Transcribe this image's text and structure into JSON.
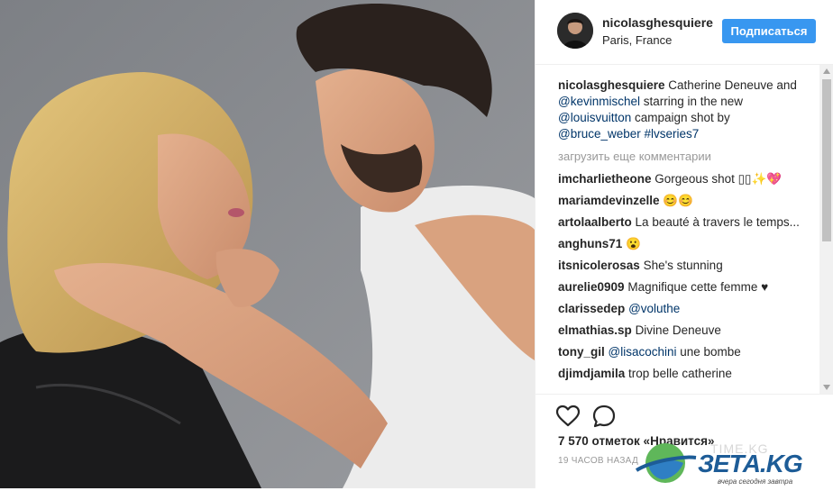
{
  "post": {
    "username": "nicolasghesquiere",
    "location": "Paris, France",
    "follow_label": "Подписаться",
    "caption": {
      "author": "nicolasghesquiere",
      "t1": " Catherine Deneuve and ",
      "m1": "@kevinmischel",
      "t2": " starring in the new ",
      "m2": "@louisvuitton",
      "t3": " campaign shot by ",
      "m3": "@bruce_weber",
      "t4": " ",
      "m4": "#lvseries7"
    },
    "load_more": "загрузить еще комментарии",
    "comments": [
      {
        "user": "imcharlietheone",
        "text": "Gorgeous shot ▯▯✨💖",
        "mention": ""
      },
      {
        "user": "mariamdevinzelle",
        "text": "😊😊",
        "mention": ""
      },
      {
        "user": "artolaalberto",
        "text": "La beauté à travers le temps...",
        "mention": ""
      },
      {
        "user": "anghuns71",
        "text": "😮",
        "mention": ""
      },
      {
        "user": "itsnicolerosas",
        "text": "She's stunning",
        "mention": ""
      },
      {
        "user": "aurelie0909",
        "text": "Magnifique cette femme ♥",
        "mention": ""
      },
      {
        "user": "clarissedep",
        "text": "",
        "mention": "@voluthe"
      },
      {
        "user": "elmathias.sp",
        "text": "Divine Deneuve",
        "mention": ""
      },
      {
        "user": "tony_gil",
        "text": " une bombe",
        "mention": "@lisacochini"
      },
      {
        "user": "djimdjamila",
        "text": "trop belle catherine",
        "mention": ""
      }
    ],
    "likes": "7 570 отметок «Нравится»",
    "time": "19 ЧАСОВ НАЗАД"
  },
  "icons": {
    "like": "heart-icon",
    "comment": "comment-bubble-icon"
  },
  "watermark": {
    "logo": "ЗЕТА.KG",
    "tagline": "вчера сегодня завтра",
    "faint": "TIME.KG"
  },
  "colors": {
    "accent": "#3897f0",
    "link": "#003569",
    "text": "#262626",
    "muted": "#999999"
  }
}
